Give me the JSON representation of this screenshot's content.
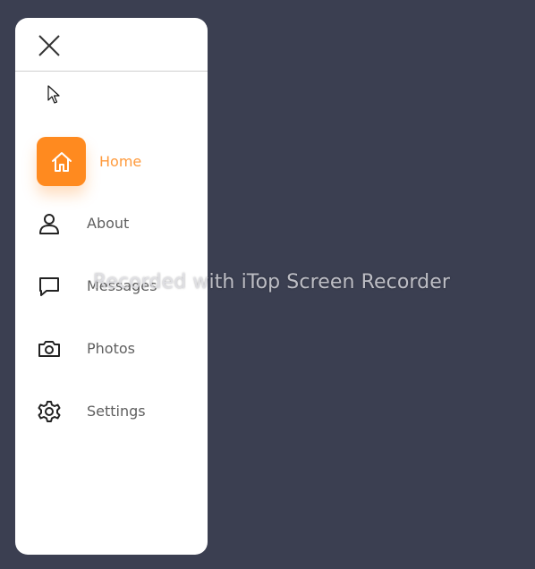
{
  "nav": {
    "close_icon": "close-icon",
    "items": [
      {
        "label": "Home",
        "icon": "home-icon",
        "active": true
      },
      {
        "label": "About",
        "icon": "user-icon",
        "active": false
      },
      {
        "label": "Messages",
        "icon": "chat-bubble-icon",
        "active": false
      },
      {
        "label": "Photos",
        "icon": "camera-icon",
        "active": false
      },
      {
        "label": "Settings",
        "icon": "gear-icon",
        "active": false
      }
    ]
  },
  "watermark": {
    "text": "Recorded with iTop Screen Recorder"
  },
  "colors": {
    "background": "#3b3f51",
    "panel": "#ffffff",
    "accent": "#ff8a1f",
    "text": "#5f5f5f"
  }
}
